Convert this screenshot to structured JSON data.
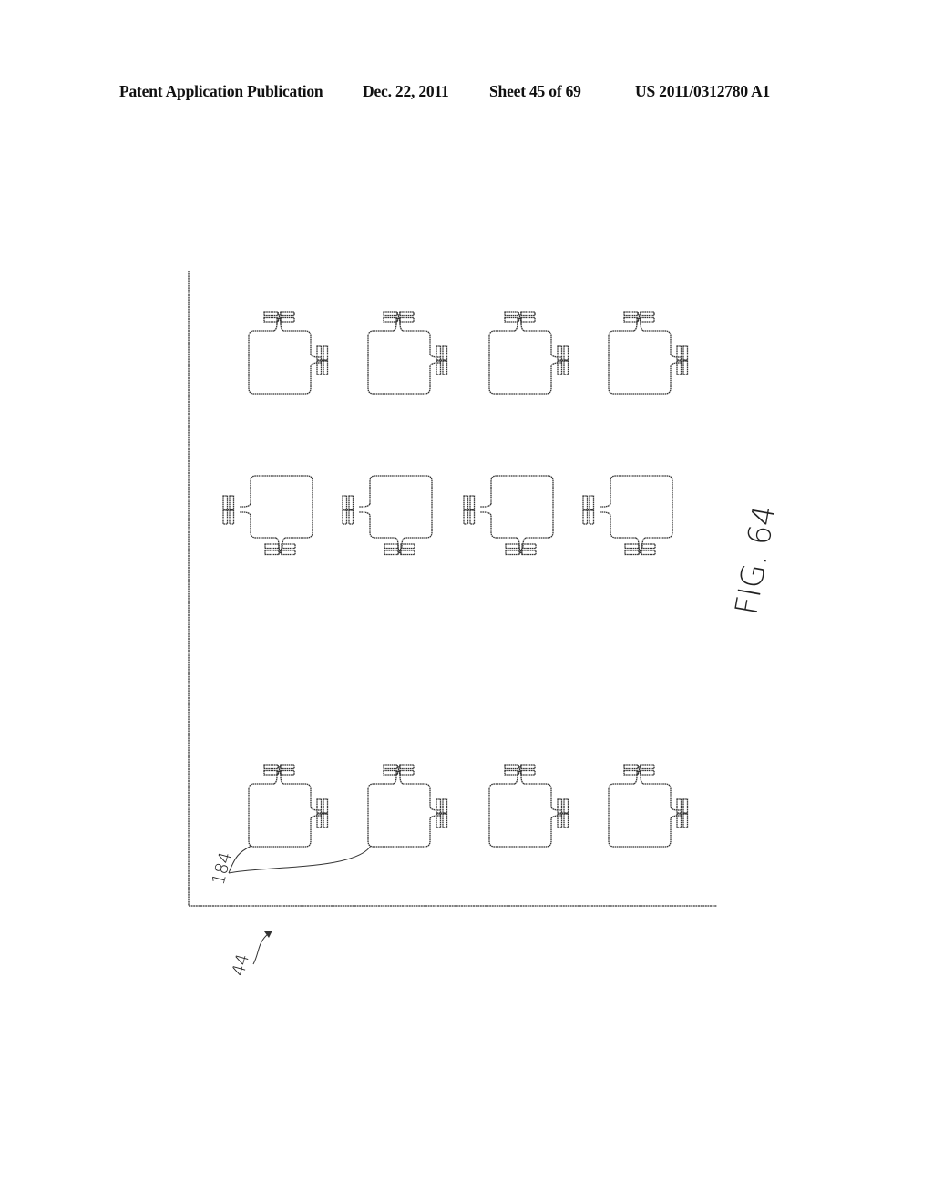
{
  "header": {
    "publication_type": "Patent Application Publication",
    "date": "Dec. 22, 2011",
    "sheet": "Sheet 45 of 69",
    "patent_number": "US 2011/0312780 A1"
  },
  "figure": {
    "label": "FIG. 64",
    "reference_numerals": {
      "tag": "184",
      "substrate": "44"
    },
    "tag_grid": {
      "rows": [
        {
          "orientation": "antennas-top-right",
          "count": 4
        },
        {
          "orientation": "antennas-left-bottom",
          "count": 4
        },
        {
          "orientation": "antennas-top-right",
          "count": 4
        }
      ]
    }
  },
  "colors": {
    "ink": "#333333",
    "background": "#ffffff"
  }
}
